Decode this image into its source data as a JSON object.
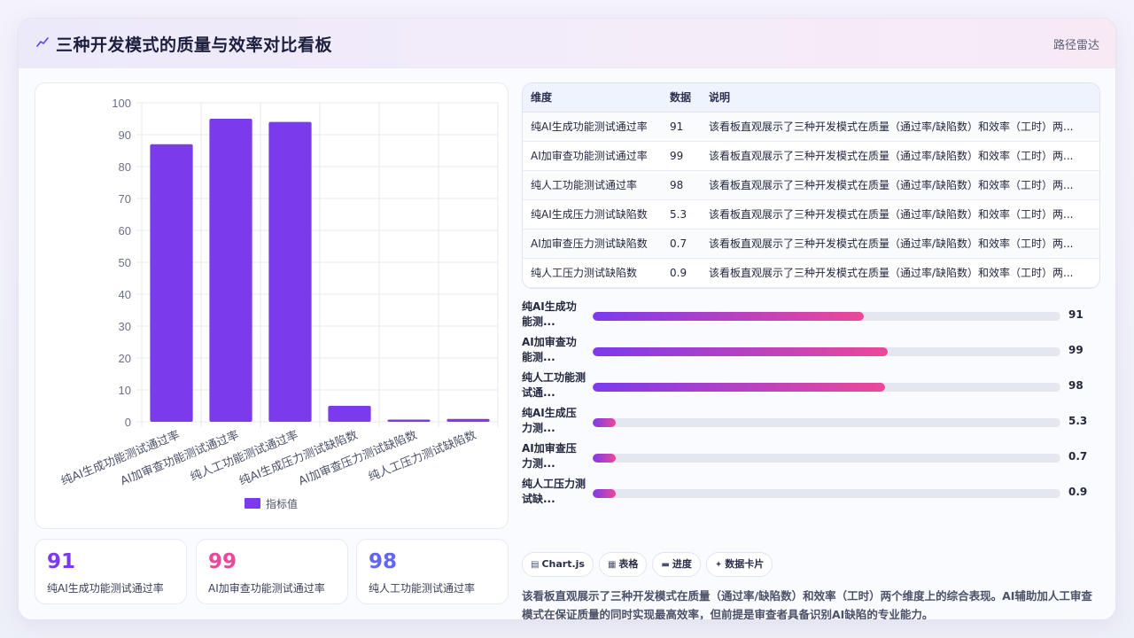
{
  "header": {
    "title": "三种开发模式的质量与效率对比看板",
    "link": "路径雷达",
    "icon": "trend-line-icon"
  },
  "chart_data": {
    "type": "bar",
    "categories": [
      "纯AI生成功能测试通过率",
      "AI加审查功能测试通过率",
      "纯人工功能测试通过率",
      "纯AI生成压力测试缺陷数",
      "AI加审查压力测试缺陷数",
      "纯人工压力测试缺陷数"
    ],
    "values": [
      87,
      95,
      94,
      5,
      0.7,
      0.9
    ],
    "series": [
      {
        "name": "指标值",
        "values": [
          87,
          95,
          94,
          5,
          0.7,
          0.9
        ]
      }
    ],
    "yticks": [
      "0",
      "10",
      "20",
      "30",
      "40",
      "50",
      "60",
      "70",
      "80",
      "90",
      "100"
    ],
    "ylim": [
      0,
      100
    ],
    "grid": true,
    "legend": "bottom",
    "color": "#7c3aed"
  },
  "kpis": [
    {
      "value": "91",
      "label": "纯AI生成功能测试通过率",
      "color": "#7c3aed"
    },
    {
      "value": "99",
      "label": "AI加审查功能测试通过率",
      "color": "#ec4899"
    },
    {
      "value": "98",
      "label": "纯人工功能测试通过率",
      "color": "#6366f1"
    }
  ],
  "table": {
    "headers": [
      "维度",
      "数据",
      "说明"
    ],
    "rows": [
      [
        "纯AI生成功能测试通过率",
        "91",
        "该看板直观展示了三种开发模式在质量（通过率/缺陷数）和效率（工时）两..."
      ],
      [
        "AI加审查功能测试通过率",
        "99",
        "该看板直观展示了三种开发模式在质量（通过率/缺陷数）和效率（工时）两..."
      ],
      [
        "纯人工功能测试通过率",
        "98",
        "该看板直观展示了三种开发模式在质量（通过率/缺陷数）和效率（工时）两..."
      ],
      [
        "纯AI生成压力测试缺陷数",
        "5.3",
        "该看板直观展示了三种开发模式在质量（通过率/缺陷数）和效率（工时）两..."
      ],
      [
        "AI加审查压力测试缺陷数",
        "0.7",
        "该看板直观展示了三种开发模式在质量（通过率/缺陷数）和效率（工时）两..."
      ],
      [
        "纯人工压力测试缺陷数",
        "0.9",
        "该看板直观展示了三种开发模式在质量（通过率/缺陷数）和效率（工时）两..."
      ]
    ]
  },
  "progress": [
    {
      "label": "纯AI生成功能测...",
      "value": "91",
      "fraction": 0.58
    },
    {
      "label": "AI加审查功能测...",
      "value": "99",
      "fraction": 0.63
    },
    {
      "label": "纯人工功能测试通...",
      "value": "98",
      "fraction": 0.625
    },
    {
      "label": "纯AI生成压力测...",
      "value": "5.3",
      "fraction": 0.05
    },
    {
      "label": "AI加审查压力测...",
      "value": "0.7",
      "fraction": 0.05
    },
    {
      "label": "纯人工压力测试缺...",
      "value": "0.9",
      "fraction": 0.05
    }
  ],
  "tags": [
    {
      "icon": "chart-icon",
      "glyph": "▤",
      "label": "Chart.js"
    },
    {
      "icon": "table-icon",
      "glyph": "▦",
      "label": "表格"
    },
    {
      "icon": "progress-icon",
      "glyph": "▬",
      "label": "进度"
    },
    {
      "icon": "sparkle-icon",
      "glyph": "✦",
      "label": "数据卡片"
    }
  ],
  "summary": "该看板直观展示了三种开发模式在质量（通过率/缺陷数）和效率（工时）两个维度上的综合表现。AI辅助加人工审查模式在保证质量的同时实现最高效率，但前提是审查者具备识别AI缺陷的专业能力。"
}
